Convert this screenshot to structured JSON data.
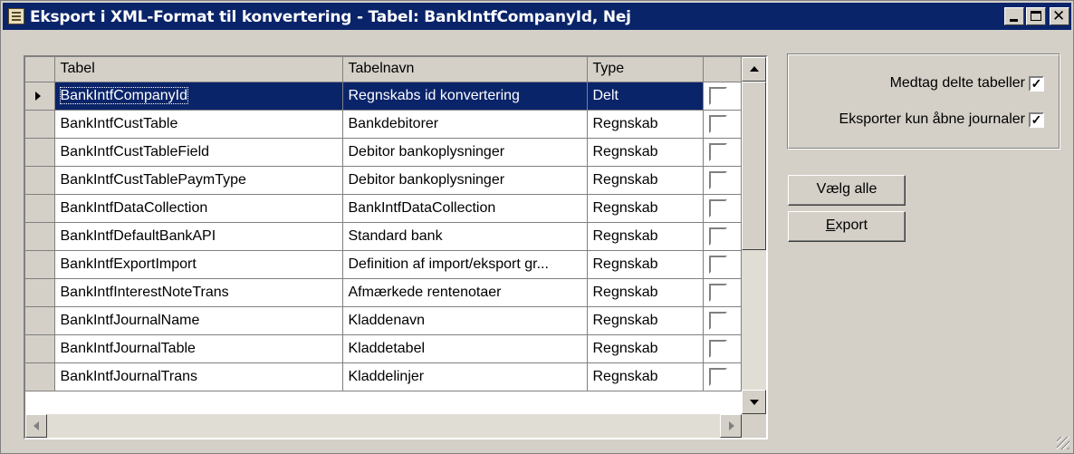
{
  "window": {
    "title": "Eksport i XML-Format til konvertering - Tabel: BankIntfCompanyId, Nej"
  },
  "grid": {
    "columns": [
      "Tabel",
      "Tabelnavn",
      "Type"
    ],
    "rows": [
      {
        "tabel": "BankIntfCompanyId",
        "navn": "Regnskabs id konvertering",
        "type": "Delt"
      },
      {
        "tabel": "BankIntfCustTable",
        "navn": "Bankdebitorer",
        "type": "Regnskab"
      },
      {
        "tabel": "BankIntfCustTableField",
        "navn": "Debitor bankoplysninger",
        "type": "Regnskab"
      },
      {
        "tabel": "BankIntfCustTablePaymType",
        "navn": "Debitor bankoplysninger",
        "type": "Regnskab"
      },
      {
        "tabel": "BankIntfDataCollection",
        "navn": "BankIntfDataCollection",
        "type": "Regnskab"
      },
      {
        "tabel": "BankIntfDefaultBankAPI",
        "navn": "Standard bank",
        "type": "Regnskab"
      },
      {
        "tabel": "BankIntfExportImport",
        "navn": "Definition af import/eksport gr...",
        "type": "Regnskab"
      },
      {
        "tabel": "BankIntfInterestNoteTrans",
        "navn": "Afmærkede rentenotaer",
        "type": "Regnskab"
      },
      {
        "tabel": "BankIntfJournalName",
        "navn": "Kladdenavn",
        "type": "Regnskab"
      },
      {
        "tabel": "BankIntfJournalTable",
        "navn": "Kladdetabel",
        "type": "Regnskab"
      },
      {
        "tabel": "BankIntfJournalTrans",
        "navn": "Kladdelinjer",
        "type": "Regnskab"
      }
    ]
  },
  "options": {
    "include_shared": "Medtag delte tabeller",
    "export_open_only": "Eksporter kun åbne journaler"
  },
  "buttons": {
    "select_all": "Vælg alle",
    "export_underline": "E",
    "export_rest": "xport"
  }
}
